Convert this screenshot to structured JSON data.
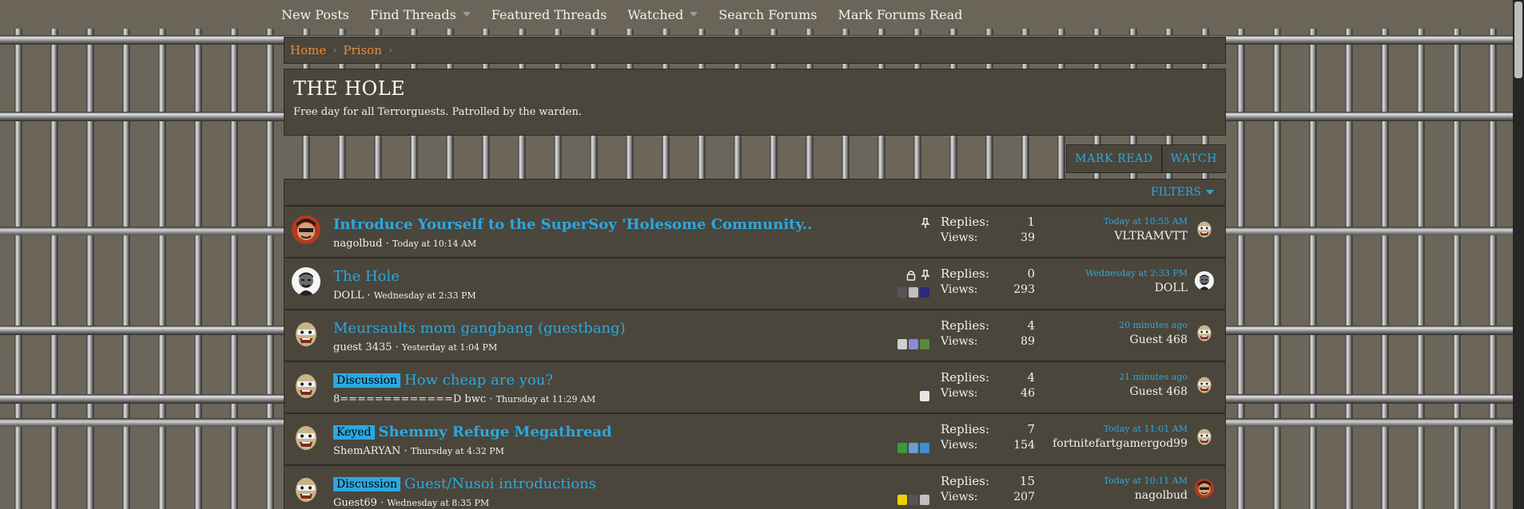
{
  "nav": {
    "items": [
      {
        "label": "New Posts",
        "caret": false
      },
      {
        "label": "Find Threads",
        "caret": true
      },
      {
        "label": "Featured Threads",
        "caret": false
      },
      {
        "label": "Watched",
        "caret": true
      },
      {
        "label": "Search Forums",
        "caret": false
      },
      {
        "label": "Mark Forums Read",
        "caret": false
      }
    ]
  },
  "breadcrumb": {
    "items": [
      "Home",
      "Prison"
    ]
  },
  "forum": {
    "title": "THE HOLE",
    "description": "Free day for all Terrorguests. Patrolled by the warden."
  },
  "actions": {
    "mark_read": "MARK READ",
    "watch": "WATCH"
  },
  "filters": {
    "label": "FILTERS"
  },
  "labels": {
    "replies": "Replies:",
    "views": "Views:"
  },
  "colors": {
    "accent": "#2ba8df",
    "crumb": "#e88c3a",
    "panel": "#4a463c"
  },
  "threads": [
    {
      "title": "Introduce Yourself to the SuperSoy 'Holesome Community..",
      "bold": true,
      "prefix": "",
      "author": "nagolbud",
      "date": "Today at 10:14 AM",
      "replies": "1",
      "views": "39",
      "last_date": "Today at 10:55 AM",
      "last_user": "VLTRAMVTT",
      "avatar": "red-face-avatar",
      "last_avatar": "guest-face-avatar",
      "status_icons": [
        "pin-icon"
      ],
      "participant_icons": []
    },
    {
      "title": "The Hole",
      "bold": false,
      "prefix": "",
      "author": "DOLL",
      "date": "Wednesday at 2:33 PM",
      "replies": "0",
      "views": "293",
      "last_date": "Wednesday at 2:33 PM",
      "last_user": "DOLL",
      "avatar": "bw-face-avatar",
      "last_avatar": "bw-face-avatar",
      "status_icons": [
        "lock-icon",
        "pin-icon"
      ],
      "participant_icons": [
        "mini-avatar-1",
        "mini-avatar-2",
        "mini-avatar-3"
      ]
    },
    {
      "title": "Meursaults mom gangbang (guestbang)",
      "bold": false,
      "prefix": "",
      "author": "guest 3435",
      "date": "Yesterday at 1:04 PM",
      "replies": "4",
      "views": "89",
      "last_date": "20 minutes ago",
      "last_user": "Guest 468",
      "avatar": "guest-face-avatar",
      "last_avatar": "guest-face-avatar",
      "status_icons": [],
      "participant_icons": [
        "mini-avatar-4",
        "mini-avatar-5",
        "mini-avatar-6"
      ]
    },
    {
      "title": "How cheap are you?",
      "bold": false,
      "prefix": "Discussion",
      "author": "8=============D bwc",
      "date": "Thursday at 11:29 AM",
      "replies": "4",
      "views": "46",
      "last_date": "21 minutes ago",
      "last_user": "Guest 468",
      "avatar": "guest-face-avatar",
      "last_avatar": "guest-face-avatar",
      "status_icons": [],
      "participant_icons": [
        "mini-avatar-7"
      ]
    },
    {
      "title": "Shemmy Refuge Megathread",
      "bold": true,
      "prefix": "Keyed",
      "author": "ShemARYAN",
      "date": "Thursday at 4:32 PM",
      "replies": "7",
      "views": "154",
      "last_date": "Today at 11:01 AM",
      "last_user": "fortnitefartgamergod99",
      "avatar": "guest-face-avatar",
      "last_avatar": "guest-face-avatar",
      "status_icons": [],
      "participant_icons": [
        "mini-avatar-8",
        "mini-avatar-9",
        "mini-avatar-10"
      ]
    },
    {
      "title": "Guest/Nusoi introductions",
      "bold": false,
      "prefix": "Discussion",
      "author": "Guest69",
      "date": "Wednesday at 8:35 PM",
      "replies": "15",
      "views": "207",
      "last_date": "Today at 10:11 AM",
      "last_user": "nagolbud",
      "avatar": "guest-face-avatar",
      "last_avatar": "red-face-avatar",
      "status_icons": [],
      "participant_icons": [
        "mini-avatar-11",
        "mini-avatar-12",
        "mini-avatar-13"
      ]
    }
  ]
}
